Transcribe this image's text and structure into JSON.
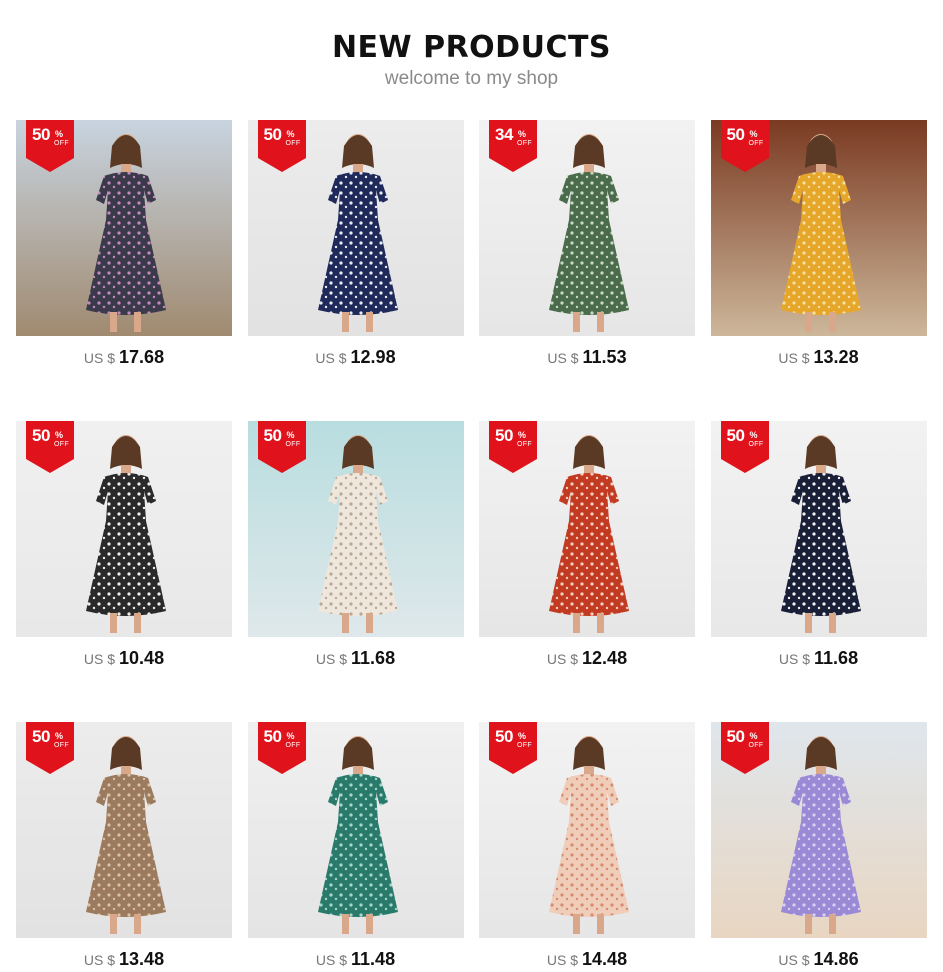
{
  "header": {
    "title": "NEW PRODUCTS",
    "subtitle": "welcome to my shop"
  },
  "currency": "US $",
  "badge_off_label": "OFF",
  "badge_pct_symbol": "%",
  "colors": {
    "badge_red": "#e0121b",
    "title": "#111111",
    "subtitle": "#8a8a8a"
  },
  "products": [
    {
      "discount": "50",
      "price": "17.68",
      "bg1": "#c8d4e0",
      "bg2": "#a08a70",
      "dress": "#3b3a4a",
      "accent": "#c48ac0"
    },
    {
      "discount": "50",
      "price": "12.98",
      "bg1": "#ececec",
      "bg2": "#e2e2e2",
      "dress": "#1f2a5a",
      "accent": "#e8ecf4"
    },
    {
      "discount": "34",
      "price": "11.53",
      "bg1": "#f2f2f2",
      "bg2": "#e6e6e6",
      "dress": "#4a6b4c",
      "accent": "#c9d8c2"
    },
    {
      "discount": "50",
      "price": "13.28",
      "bg1": "#7a3a22",
      "bg2": "#cdb79a",
      "dress": "#e6a62a",
      "accent": "#f4e0a0"
    },
    {
      "discount": "50",
      "price": "10.48",
      "bg1": "#f0f0f0",
      "bg2": "#e8e8e8",
      "dress": "#2a2a2a",
      "accent": "#f0f0f0"
    },
    {
      "discount": "50",
      "price": "11.68",
      "bg1": "#b8dde0",
      "bg2": "#dfe8ea",
      "dress": "#efe6dc",
      "accent": "#b8a898"
    },
    {
      "discount": "50",
      "price": "12.48",
      "bg1": "#f2f2f2",
      "bg2": "#e6e6e6",
      "dress": "#c23a22",
      "accent": "#f4d0c0"
    },
    {
      "discount": "50",
      "price": "11.68",
      "bg1": "#f2f2f2",
      "bg2": "#e8e8e8",
      "dress": "#1a1f38",
      "accent": "#f2f2f2"
    },
    {
      "discount": "50",
      "price": "13.48",
      "bg1": "#ececec",
      "bg2": "#e2e2e2",
      "dress": "#9b7a5e",
      "accent": "#d9c2a8"
    },
    {
      "discount": "50",
      "price": "11.48",
      "bg1": "#f0f0f0",
      "bg2": "#e4e4e4",
      "dress": "#2a7a6c",
      "accent": "#a8d6cc"
    },
    {
      "discount": "50",
      "price": "14.48",
      "bg1": "#f2f2f2",
      "bg2": "#e6e6e6",
      "dress": "#f0cdb8",
      "accent": "#d88a70"
    },
    {
      "discount": "50",
      "price": "14.86",
      "bg1": "#dfe6ec",
      "bg2": "#e8d6c2",
      "dress": "#9a8ad6",
      "accent": "#d8d0f0"
    }
  ]
}
